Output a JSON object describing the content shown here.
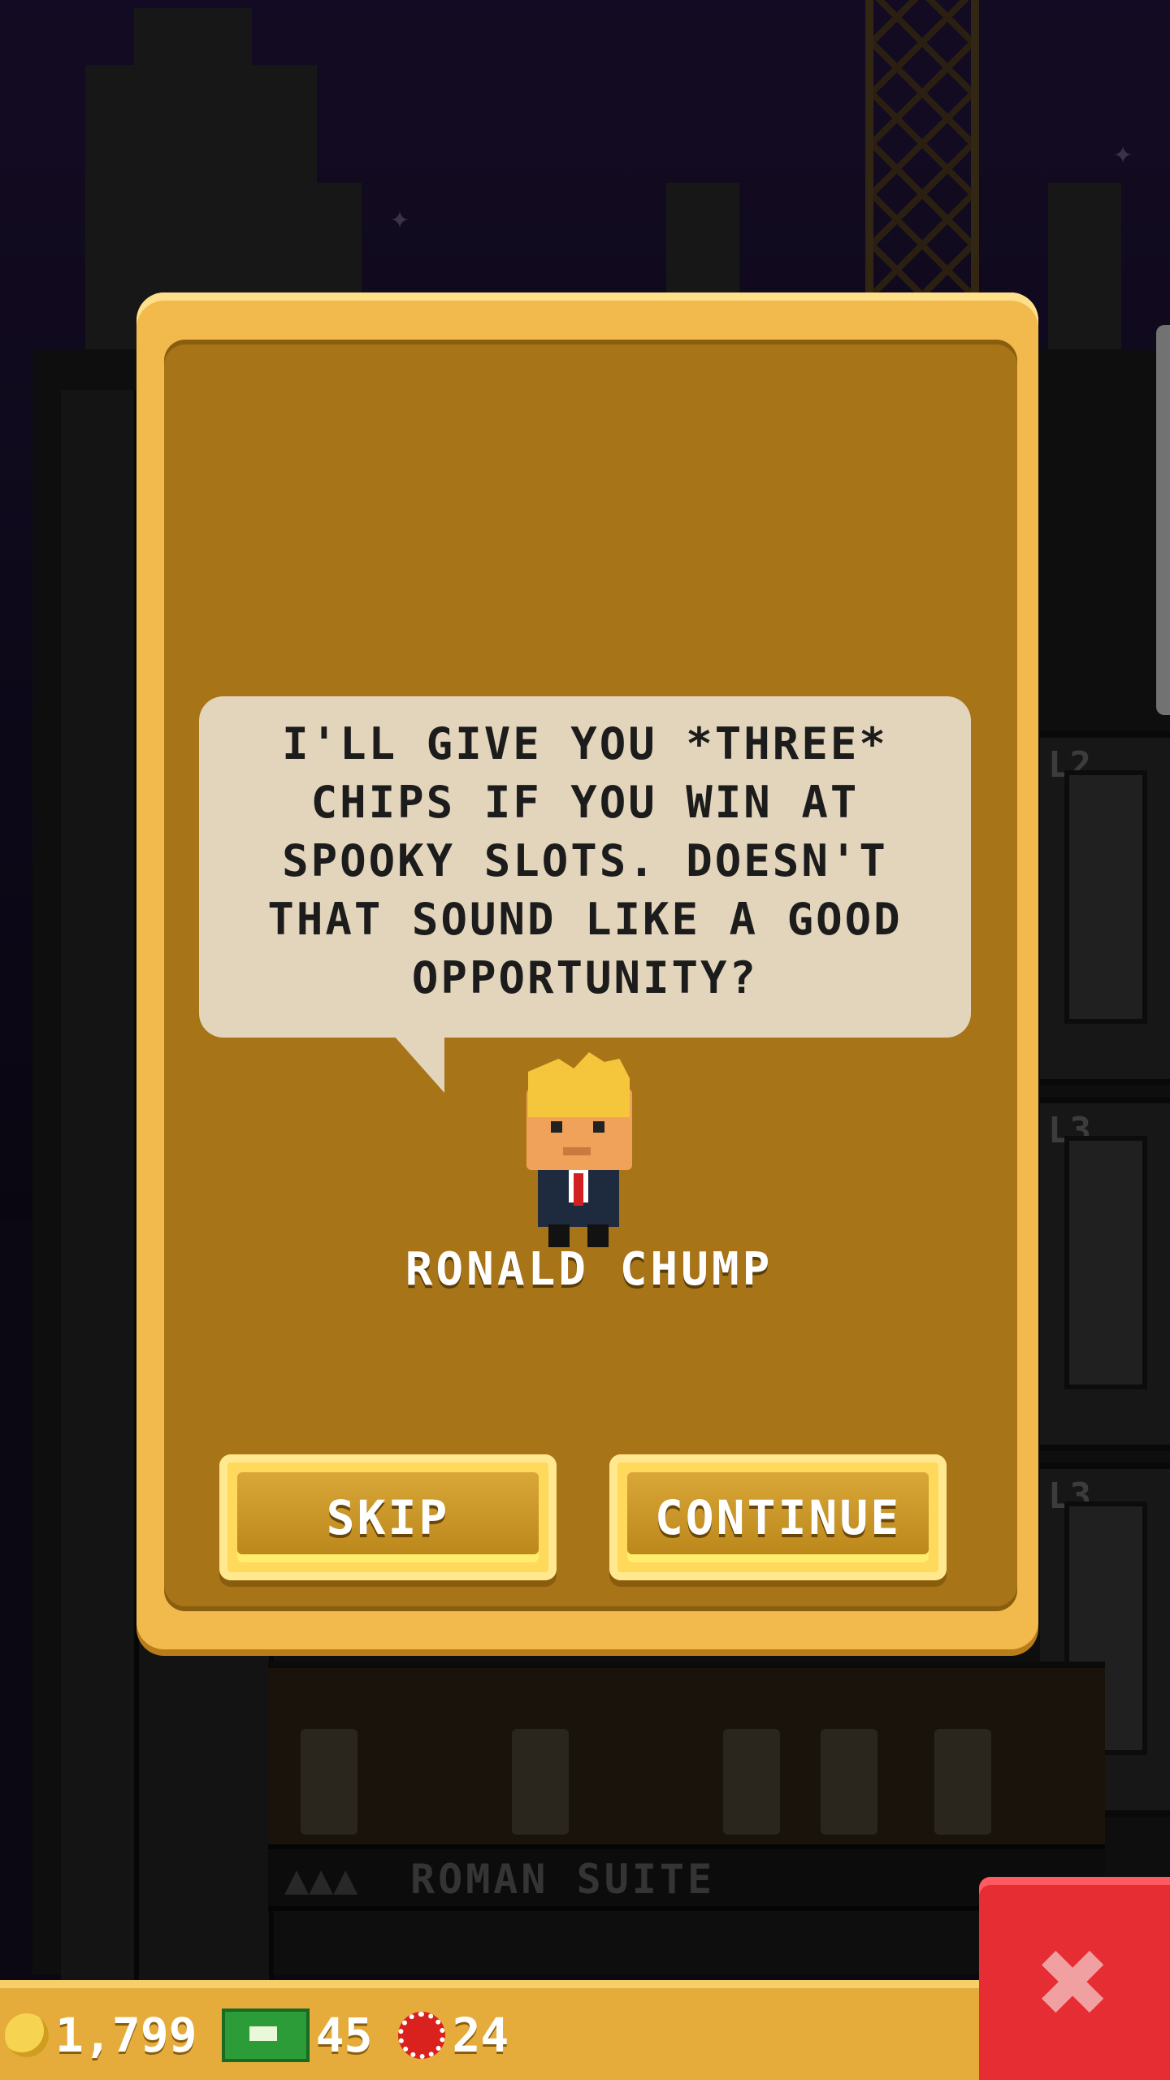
{
  "dialog": {
    "message": "I'LL GIVE YOU *THREE*\nCHIPS IF YOU WIN AT\nSPOOKY SLOTS. DOESN'T\nTHAT SOUND LIKE A GOOD\nOPPORTUNITY?",
    "character_name": "RONALD CHUMP",
    "skip_label": "SKIP",
    "continue_label": "CONTINUE"
  },
  "background": {
    "room_label": "ROMAN SUITE",
    "floor_tags": [
      "L2",
      "L3",
      "L3"
    ]
  },
  "resources": {
    "coins": "1,799",
    "bux": "45",
    "chips": "24"
  },
  "colors": {
    "dialog_border": "#f2b94c",
    "dialog_fill": "#a77418",
    "bubble": "#e3d5bb",
    "close_button": "#e52d33"
  },
  "icons": {
    "coin": "coin-icon",
    "bux": "bux-icon",
    "chip": "chip-icon",
    "close": "close-icon"
  }
}
